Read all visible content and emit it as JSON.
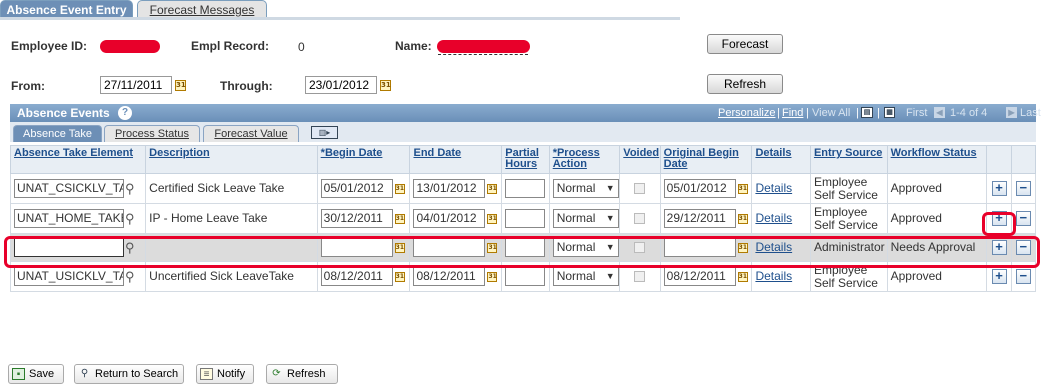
{
  "tabs": [
    {
      "label": "Absence Event Entry",
      "active": true
    },
    {
      "label": "Forecast Messages",
      "active": false
    }
  ],
  "header": {
    "employee_id_label": "Employee ID:",
    "empl_record_label": "Empl Record:",
    "empl_record_value": "0",
    "name_label": "Name:",
    "forecast_button": "Forecast",
    "refresh_button": "Refresh",
    "from_label": "From:",
    "from_value": "27/11/2011",
    "through_label": "Through:",
    "through_value": "23/01/2012"
  },
  "grid": {
    "title": "Absence Events",
    "personalize": "Personalize",
    "find": "Find",
    "view_all": "View All",
    "first": "First",
    "range": "1-4 of 4",
    "last": "Last",
    "subtabs": [
      "Absence Take",
      "Process Status",
      "Forecast Value"
    ],
    "columns": [
      "Absence Take Element",
      "Description",
      "*Begin Date",
      "End Date",
      "Partial Hours",
      "*Process Action",
      "Voided",
      "Original Begin Date",
      "Details",
      "Entry Source",
      "Workflow Status"
    ],
    "rows": [
      {
        "element": "UNAT_CSICKLV_TA",
        "description": "Certified Sick Leave Take",
        "begin": "05/01/2012",
        "end": "13/01/2012",
        "partial": "",
        "action": "Normal",
        "original": "05/01/2012",
        "details": "Details",
        "source": "Employee Self Service",
        "status": "Approved"
      },
      {
        "element": "UNAT_HOME_TAKE",
        "description": "IP - Home Leave Take",
        "begin": "30/12/2011",
        "end": "04/01/2012",
        "partial": "",
        "action": "Normal",
        "original": "29/12/2011",
        "details": "Details",
        "source": "Employee Self Service",
        "status": "Approved"
      },
      {
        "element": "",
        "description": "",
        "begin": "",
        "end": "",
        "partial": "",
        "action": "Normal",
        "original": "",
        "details": "Details",
        "source": "Administrator",
        "status": "Needs Approval"
      },
      {
        "element": "UNAT_USICKLV_TA",
        "description": "Uncertified Sick LeaveTake",
        "begin": "08/12/2011",
        "end": "08/12/2011",
        "partial": "",
        "action": "Normal",
        "original": "08/12/2011",
        "details": "Details",
        "source": "Employee Self Service",
        "status": "Approved"
      }
    ]
  },
  "footer": {
    "save": "Save",
    "return": "Return to Search",
    "notify": "Notify",
    "refresh": "Refresh"
  },
  "colors": {
    "accent": "#6d8fb6",
    "link": "#1e4f8c",
    "highlight": "#e8002a"
  }
}
